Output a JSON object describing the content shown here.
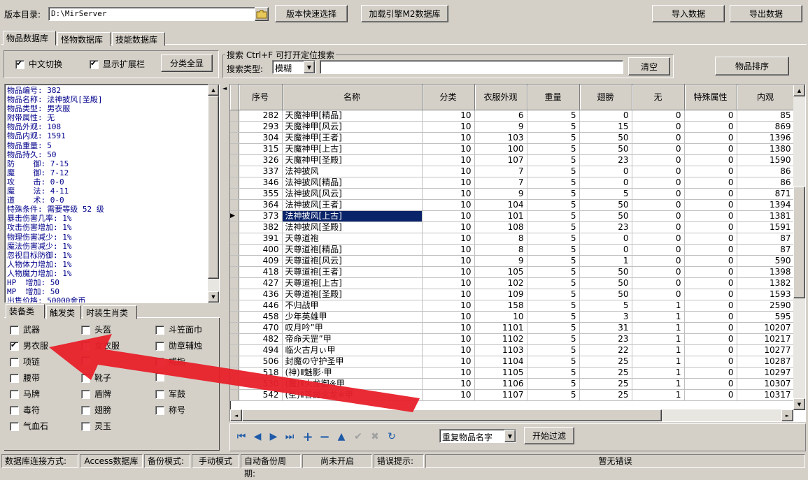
{
  "top": {
    "dir_label": "版本目录:",
    "dir_value": "D:\\MirServer",
    "btn_quick_select": "版本快速选择",
    "btn_load_engine": "加载引擎M2数据库",
    "btn_import": "导入数据",
    "btn_export": "导出数据"
  },
  "tabs": [
    "物品数据库",
    "怪物数据库",
    "技能数据库"
  ],
  "options": {
    "chinese_switch": "中文切换",
    "show_ext": "显示扩展栏",
    "btn_show_all": "分类全显"
  },
  "search": {
    "group_title": "搜索  Ctrl+F 可打开定位搜索",
    "type_label": "搜索类型:",
    "type_value": "模糊",
    "btn_clear": "清空",
    "btn_sort": "物品排序"
  },
  "info_lines": [
    "物品编号: 382",
    "物品名称: 法神披风[圣殿]",
    "物品类型: 男衣服",
    "附带属性: 无",
    "物品外观: 108",
    "物品内观: 1591",
    "物品重量: 5",
    "物品持久: 50",
    "防    御: 7-15",
    "魔    御: 7-12",
    "攻    击: 0-0",
    "魔    法: 4-11",
    "道    术: 0-0",
    "特殊条件: 需要等级 52 级",
    "暴击伤害几率: 1%",
    "攻击伤害增加: 1%",
    "物理伤害减少: 1%",
    "魔法伤害减少: 1%",
    "忽视目标防御: 1%",
    "人物体力增加: 1%",
    "人物魔力增加: 1%",
    "HP  增加: 50",
    "MP  增加: 50",
    "出售价格: 50000金币"
  ],
  "cat_tabs": [
    "装备类",
    "触发类",
    "时装生肖类"
  ],
  "categories": [
    {
      "label": "武器",
      "checked": false
    },
    {
      "label": "头盔",
      "checked": false
    },
    {
      "label": "斗笠面巾",
      "checked": false
    },
    {
      "label": "男衣服",
      "checked": true
    },
    {
      "label": "女衣服",
      "checked": false
    },
    {
      "label": "勋章辅烛",
      "checked": false
    },
    {
      "label": "项链",
      "checked": false
    },
    {
      "label": "",
      "checked": false
    },
    {
      "label": "戒指",
      "checked": false
    },
    {
      "label": "腰带",
      "checked": false
    },
    {
      "label": "靴子",
      "checked": false
    },
    {
      "label": "",
      "checked": false
    },
    {
      "label": "马牌",
      "checked": false
    },
    {
      "label": "盾牌",
      "checked": false
    },
    {
      "label": "军鼓",
      "checked": false
    },
    {
      "label": "毒符",
      "checked": false
    },
    {
      "label": "翅膀",
      "checked": false
    },
    {
      "label": "称号",
      "checked": false
    },
    {
      "label": "气血石",
      "checked": false
    },
    {
      "label": "灵玉",
      "checked": false
    }
  ],
  "grid": {
    "headers": [
      "序号",
      "名称",
      "分类",
      "衣服外观",
      "重量",
      "翅膀",
      "无",
      "特殊属性",
      "内观"
    ],
    "selected_row": 9,
    "rows": [
      [
        "282",
        "天魔神甲[精品]",
        "10",
        "6",
        "5",
        "0",
        "0",
        "0",
        "85"
      ],
      [
        "293",
        "天魔神甲[风云]",
        "10",
        "9",
        "5",
        "15",
        "0",
        "0",
        "869"
      ],
      [
        "304",
        "天魔神甲[王者]",
        "10",
        "103",
        "5",
        "50",
        "0",
        "0",
        "1396"
      ],
      [
        "315",
        "天魔神甲[上古]",
        "10",
        "100",
        "5",
        "50",
        "0",
        "0",
        "1380"
      ],
      [
        "326",
        "天魔神甲[圣殿]",
        "10",
        "107",
        "5",
        "23",
        "0",
        "0",
        "1590"
      ],
      [
        "337",
        "法神披风",
        "10",
        "7",
        "5",
        "0",
        "0",
        "0",
        "86"
      ],
      [
        "346",
        "法神披风[精品]",
        "10",
        "7",
        "5",
        "0",
        "0",
        "0",
        "86"
      ],
      [
        "355",
        "法神披风[风云]",
        "10",
        "9",
        "5",
        "5",
        "0",
        "0",
        "871"
      ],
      [
        "364",
        "法神披风[王者]",
        "10",
        "104",
        "5",
        "50",
        "0",
        "0",
        "1394"
      ],
      [
        "373",
        "法神披风[上古]",
        "10",
        "101",
        "5",
        "50",
        "0",
        "0",
        "1381"
      ],
      [
        "382",
        "法神披风[圣殿]",
        "10",
        "108",
        "5",
        "23",
        "0",
        "0",
        "1591"
      ],
      [
        "391",
        "天尊道袍",
        "10",
        "8",
        "5",
        "0",
        "0",
        "0",
        "87"
      ],
      [
        "400",
        "天尊道袍[精品]",
        "10",
        "8",
        "5",
        "0",
        "0",
        "0",
        "87"
      ],
      [
        "409",
        "天尊道袍[风云]",
        "10",
        "9",
        "5",
        "1",
        "0",
        "0",
        "590"
      ],
      [
        "418",
        "天尊道袍[王者]",
        "10",
        "105",
        "5",
        "50",
        "0",
        "0",
        "1398"
      ],
      [
        "427",
        "天尊道袍[上古]",
        "10",
        "102",
        "5",
        "50",
        "0",
        "0",
        "1382"
      ],
      [
        "436",
        "天尊道袍[圣殿]",
        "10",
        "109",
        "5",
        "50",
        "0",
        "0",
        "1593"
      ],
      [
        "446",
        "不归战甲",
        "10",
        "158",
        "5",
        "5",
        "1",
        "0",
        "2590"
      ],
      [
        "458",
        "少年英雄甲",
        "10",
        "10",
        "5",
        "3",
        "1",
        "0",
        "595"
      ],
      [
        "470",
        "叹月吟”甲",
        "10",
        "1101",
        "5",
        "31",
        "1",
        "0",
        "10207"
      ],
      [
        "482",
        "帝命天罡”甲",
        "10",
        "1102",
        "5",
        "23",
        "1",
        "0",
        "10217"
      ],
      [
        "494",
        "临火古月ぃ甲",
        "10",
        "1103",
        "5",
        "22",
        "1",
        "0",
        "10277"
      ],
      [
        "506",
        "封魔の守护圣甲",
        "10",
        "1104",
        "5",
        "25",
        "1",
        "0",
        "10287"
      ],
      [
        "518",
        "(神)Ⅱ魅影·甲",
        "10",
        "1105",
        "5",
        "25",
        "1",
        "0",
        "10297"
      ],
      [
        "530",
        "(魔)Ⅱ火龙御※甲",
        "10",
        "1106",
        "5",
        "25",
        "1",
        "0",
        "10307"
      ],
      [
        "542",
        "(圣)Ⅱ菩提火龙※甲",
        "10",
        "1107",
        "5",
        "25",
        "1",
        "0",
        "10317"
      ]
    ]
  },
  "nav": {
    "filter_value": "重复物品名字",
    "btn_filter": "开始过滤"
  },
  "status": {
    "conn_label": "数据库连接方式:",
    "conn_value": "Access数据库",
    "backup_label": "备份模式:",
    "backup_value": "手动模式",
    "auto_label": "自动备份周期:",
    "auto_value": "尚未开启",
    "err_label": "错误提示:",
    "err_value": "暂无错误"
  },
  "colors": {
    "face": "#d4d0c8",
    "info_text": "#00008b",
    "selection": "#0a246a",
    "arrow": "#e8202a"
  }
}
